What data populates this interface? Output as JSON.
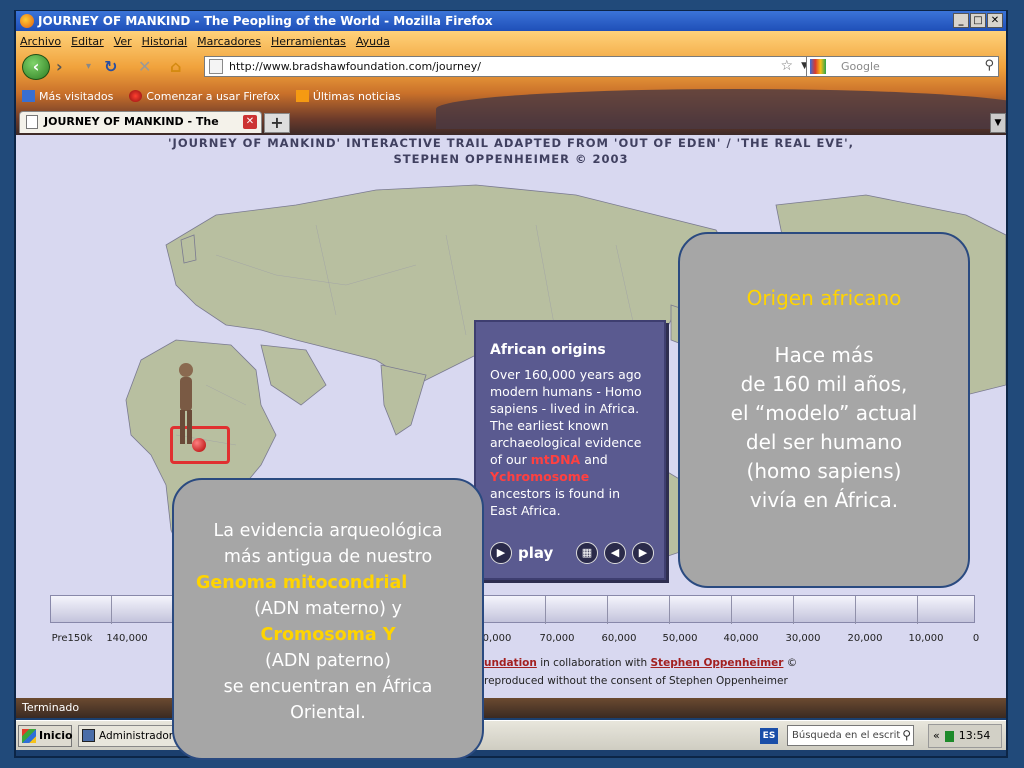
{
  "window": {
    "title": "JOURNEY OF MANKIND - The Peopling of the World - Mozilla Firefox",
    "controls": [
      "_",
      "□",
      "✕"
    ]
  },
  "menu": [
    "Archivo",
    "Editar",
    "Ver",
    "Historial",
    "Marcadores",
    "Herramientas",
    "Ayuda"
  ],
  "navbar": {
    "url": "http://www.bradshawfoundation.com/journey/",
    "search_placeholder": "Google"
  },
  "bookmarks": [
    "Más visitados",
    "Comenzar a usar Firefox",
    "Últimas noticias"
  ],
  "tab": {
    "label": "JOURNEY OF MANKIND - The Peopl..."
  },
  "page": {
    "header_line1": "'JOURNEY OF MANKIND' INTERACTIVE TRAIL ADAPTED FROM 'OUT OF EDEN' / 'THE REAL EVE',",
    "header_line2": "STEPHEN OPPENHEIMER © 2003",
    "african_box": {
      "title": "African origins",
      "text_1": "Over 160,000 years ago modern humans - Homo sapiens - lived in Africa. The earliest known archaeological evidence of our",
      "mtdna": "mtDNA",
      "and": "and",
      "ychrom": "Ychromosome",
      "text_2": "ancestors is found in East Africa.",
      "play": "play"
    },
    "timeline_ticks": [
      "Pre150k",
      "140,000",
      "0,000",
      "70,000",
      "60,000",
      "50,000",
      "40,000",
      "30,000",
      "20,000",
      "10,000",
      "0"
    ],
    "credit_link": "undation",
    "credit_middle": "in collaboration with",
    "credit_name": "Stephen Oppenheimer",
    "credit_copy": "©",
    "credit_line2": "reproduced without the consent of Stephen Oppenheimer"
  },
  "statusbar": {
    "text": "Terminado"
  },
  "taskbar": {
    "start": "Inicio",
    "task": "Administrador de",
    "lang": "ES",
    "search": "Búsqueda en el escrit",
    "tray_arrows": "«",
    "clock": "13:54"
  },
  "callout_right": {
    "heading": "Origen africano",
    "lines": [
      "Hace más",
      "de 160 mil años,",
      "el “modelo” actual",
      "del ser humano",
      "(homo sapiens)",
      "vivía en África."
    ]
  },
  "callout_left": {
    "line1": "La evidencia arqueológica",
    "line2": "más antigua de nuestro",
    "genome": "Genoma mitocondrial",
    "line3": "(ADN materno) y",
    "ychrom": "Cromosoma Y",
    "line4": "(ADN paterno)",
    "line5": "se encuentran en África",
    "line6": "Oriental."
  },
  "colors": {
    "accent_yellow": "#ffd400",
    "dna_red": "#ff4040",
    "marker_red": "#e03030",
    "callout_gray": "#a6a6a6"
  }
}
